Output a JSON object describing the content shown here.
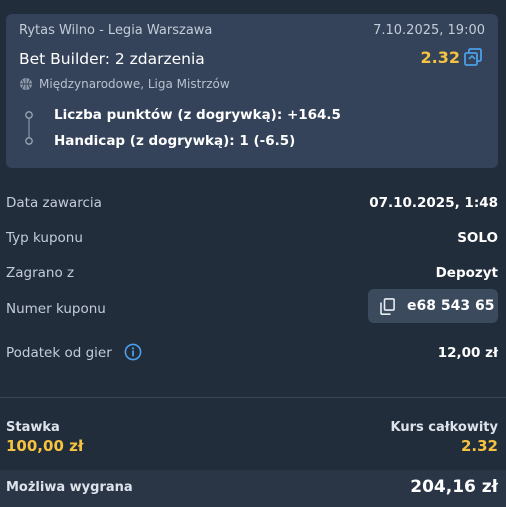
{
  "event": {
    "match": "Rytas Wilno - Legia Warszawa",
    "date": "7.10.2025, 19:00",
    "bet_builder_title": "Bet Builder: 2 zdarzenia",
    "odds": "2.32",
    "league": "Międzynarodowe, Liga Mistrzów",
    "legs": [
      "Liczba punktów (z dogrywką): +164.5",
      "Handicap (z dogrywką): 1 (-6.5)"
    ]
  },
  "details": {
    "data_zawarcia": {
      "label": "Data zawarcia",
      "value": "07.10.2025, 1:48"
    },
    "typ_kuponu": {
      "label": "Typ kuponu",
      "value": "SOLO"
    },
    "zagrano_z": {
      "label": "Zagrano z",
      "value": "Depozyt"
    },
    "numer_kuponu": {
      "label": "Numer kuponu",
      "value": "e68 543 65"
    },
    "podatek": {
      "label": "Podatek od gier",
      "value": "12,00 zł"
    }
  },
  "summary": {
    "stake_label": "Stawka",
    "stake_value": "100,00 zł",
    "total_odds_label": "Kurs całkowity",
    "total_odds_value": "2.32",
    "win_label": "Możliwa wygrana",
    "win_value": "204,16 zł"
  },
  "colors": {
    "background": "#222d3c",
    "card": "#34435a",
    "accent": "#f6c340",
    "link_icon": "#4a9fe8"
  },
  "icons": [
    "copy-icon",
    "basketball-icon",
    "timeline-dots",
    "copy-code-icon",
    "info-icon"
  ]
}
